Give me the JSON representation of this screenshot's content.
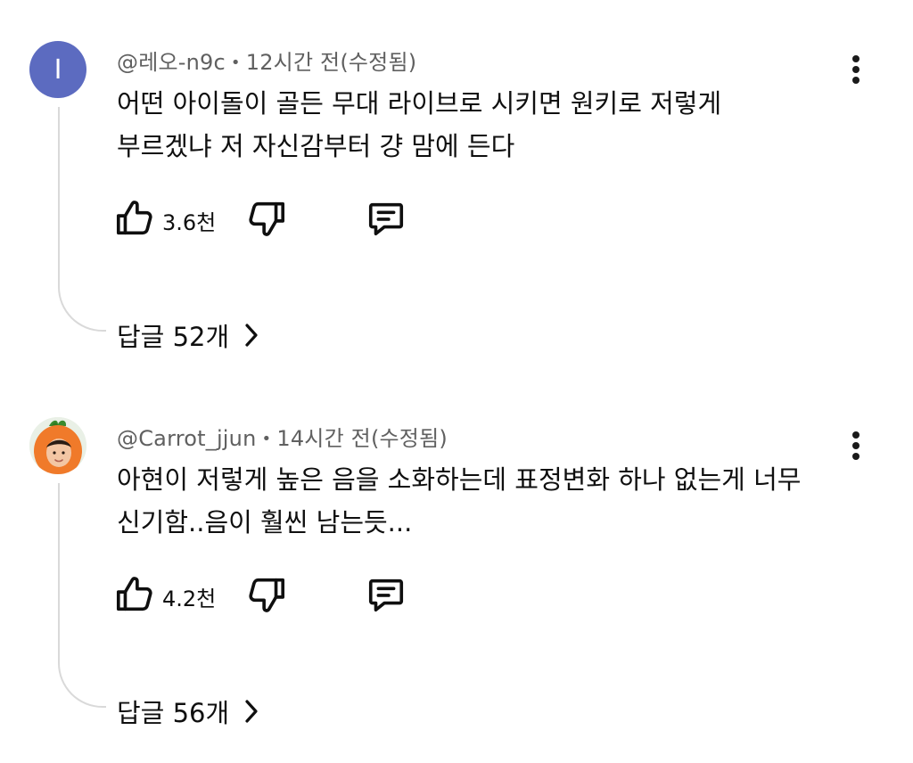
{
  "comments": [
    {
      "handle": "@레오-n9c",
      "separator": "•",
      "time": "12시간 전(수정됨)",
      "avatar_letter": "I",
      "avatar_color": "#5c6bc0",
      "line1": "어떤 아이돌이 골든 무대 라이브로 시키면 원키로 저렇게",
      "line2": "부르겠냐 저 자신감부터 걍 맘에 든다",
      "likes": "3.6천",
      "replies": "답글 52개"
    },
    {
      "handle": "@Carrot_jjun",
      "separator": "•",
      "time": "14시간 전(수정됨)",
      "avatar_icon": "carrot-avatar-photo",
      "line1": "아현이 저렇게 높은 음을 소화하는데 표정변화 하나 없는게 너무",
      "line2": "신기함..음이 훨씬 남는듯...",
      "likes": "4.2천",
      "replies": "답글 56개"
    }
  ],
  "icons": {
    "like": "thumbs-up-icon",
    "dislike": "thumbs-down-icon",
    "reply": "comment-icon",
    "menu": "more-vert-icon",
    "expand": "chevron-right-icon"
  }
}
